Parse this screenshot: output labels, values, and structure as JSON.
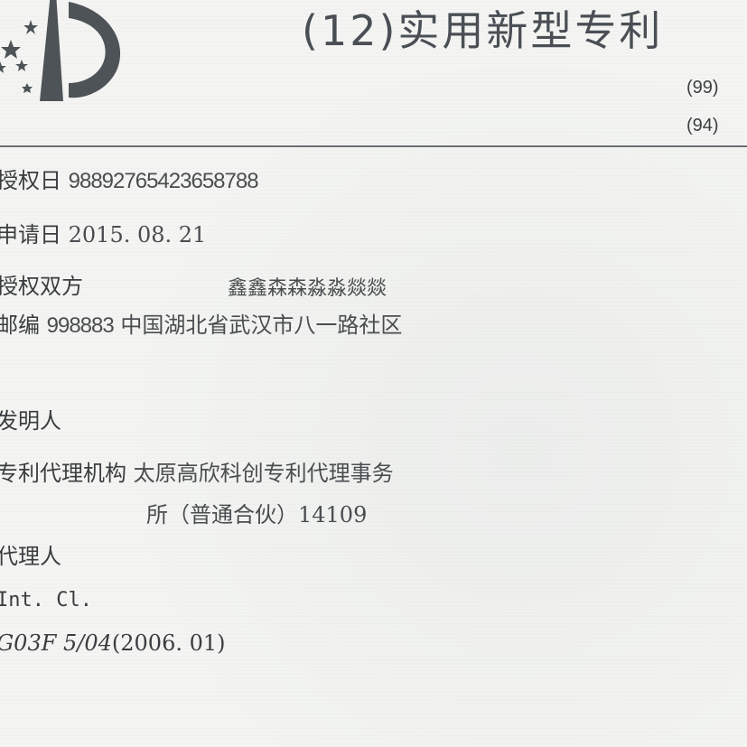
{
  "header": {
    "doc_type": "(12)实用新型专利",
    "code_99": "(99)",
    "code_94": "(94)"
  },
  "fields": {
    "grant_date_label": "授权日",
    "grant_date_value": "98892765423658788",
    "application_date_label": "申请日",
    "application_date_value": "2015. 08. 21",
    "grantees_label": "授权双方",
    "grantees_value": "鑫鑫森森淼淼燚燚",
    "zip_label": "邮编",
    "zip_value": "998883",
    "address_value": "中国湖北省武汉市八一路社区",
    "inventor_label": "发明人",
    "agency_label": "专利代理机构",
    "agency_value_line1": "太原高欣科创专利代理事务",
    "agency_value_line2": "所（普通合伙）14109",
    "agent_label": "代理人",
    "int_cl_label": "Int. Cl.",
    "ipc_code": "G03F 5/04",
    "ipc_version": "(2006. 01)"
  },
  "colors": {
    "background": "#f4f5f2",
    "text": "#3a3d40",
    "logo": "#4e5358",
    "rule": "#6a6e72"
  }
}
